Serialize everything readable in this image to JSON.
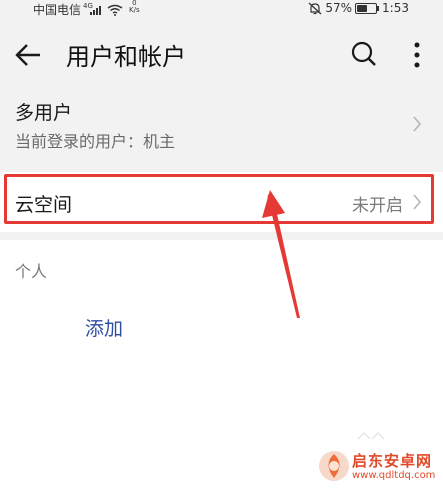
{
  "status_bar": {
    "carrier": "中国电信",
    "network": "4G",
    "speed_value": "0",
    "speed_unit": "K/s",
    "battery": "57%",
    "battery_level": 0.57,
    "time": "1:53"
  },
  "header": {
    "title": "用户和帐户",
    "icons": [
      "back-arrow",
      "search",
      "more-vertical"
    ]
  },
  "multi_user": {
    "title": "多用户",
    "subtitle": "当前登录的用户：机主"
  },
  "cloud": {
    "title": "云空间",
    "status": "未开启"
  },
  "personal": {
    "section_label": "个人",
    "add_label": "添加"
  },
  "annotation": {
    "highlight_color": "#e53935"
  },
  "watermark": {
    "name": "启东安卓网",
    "url": "www.qdltdq.com"
  },
  "colors": {
    "link": "#2f4ea0",
    "background": "#f2f2f2"
  }
}
